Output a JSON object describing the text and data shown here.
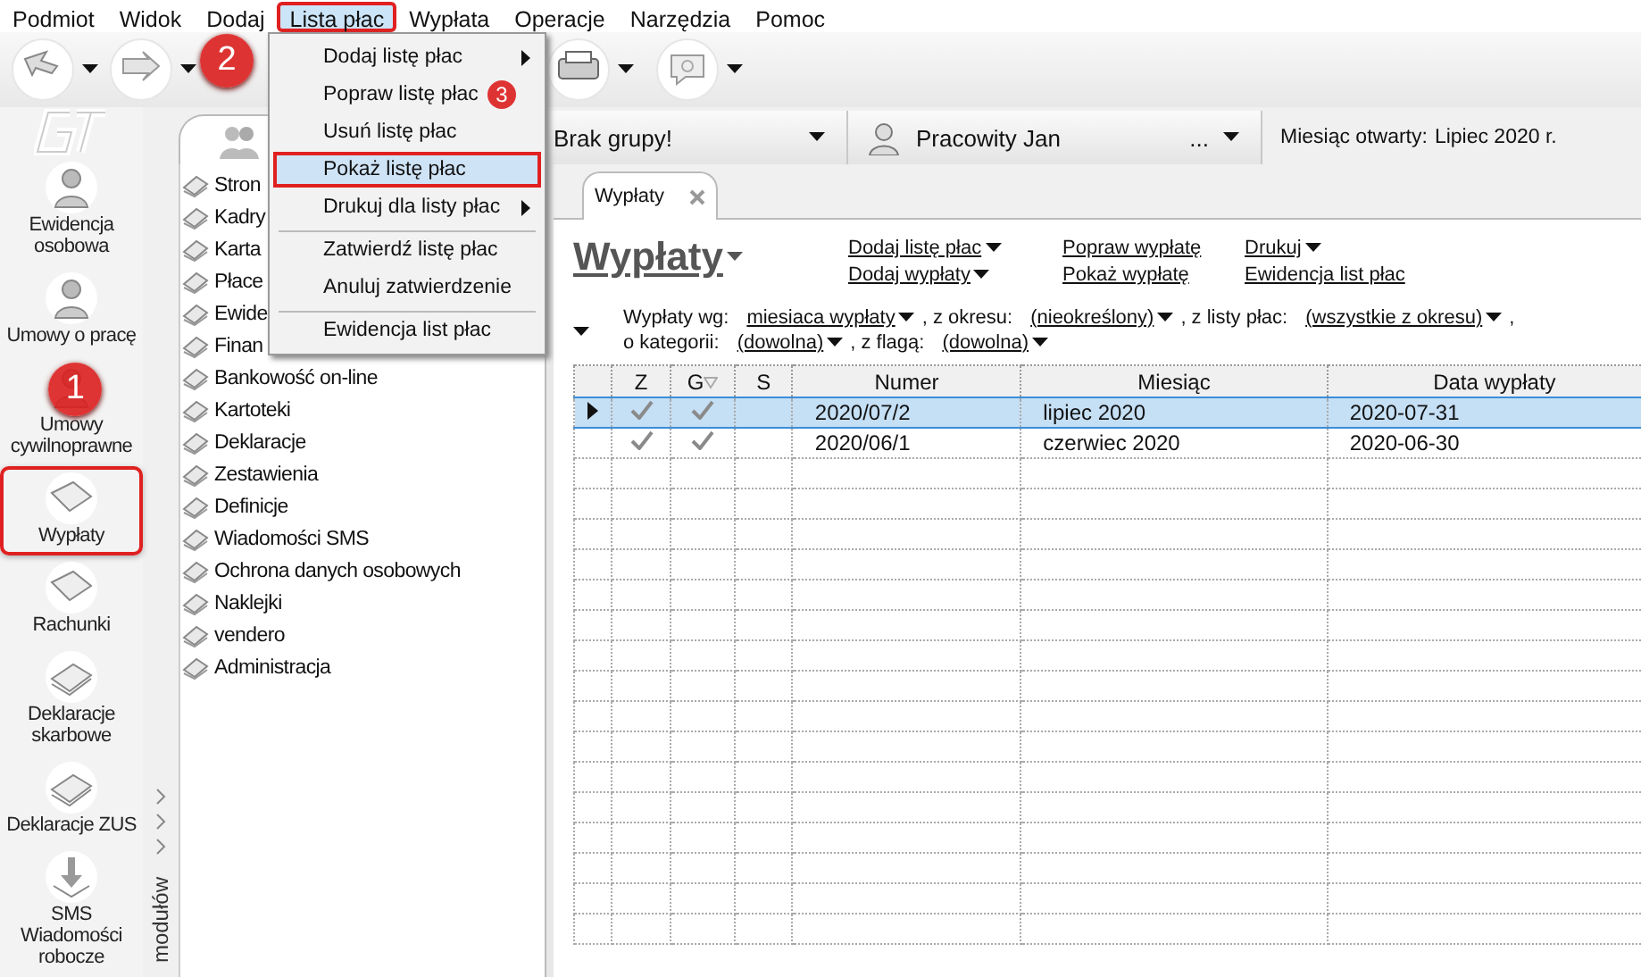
{
  "menu_bar": [
    {
      "label": "Podmiot",
      "highlighted": false
    },
    {
      "label": "Widok",
      "highlighted": false
    },
    {
      "label": "Dodaj",
      "highlighted": false
    },
    {
      "label": "Lista płac",
      "highlighted": true
    },
    {
      "label": "Wypłata",
      "highlighted": false
    },
    {
      "label": "Operacje",
      "highlighted": false
    },
    {
      "label": "Narzędzia",
      "highlighted": false
    },
    {
      "label": "Pomoc",
      "highlighted": false
    }
  ],
  "modules": [
    {
      "label": "Ewidencja osobowa",
      "highlighted": false
    },
    {
      "label": "Umowy o pracę",
      "highlighted": false
    },
    {
      "label": "Umowy cywilnoprawne",
      "highlighted": false
    },
    {
      "label": "Wypłaty",
      "highlighted": true
    },
    {
      "label": "Rachunki",
      "highlighted": false
    },
    {
      "label": "Deklaracje skarbowe",
      "highlighted": false
    },
    {
      "label": "Deklaracje ZUS",
      "highlighted": false
    },
    {
      "label": "SMS Wiadomości robocze",
      "highlighted": false
    }
  ],
  "modules_strip": {
    "label": "modułów"
  },
  "navigation": [
    {
      "label": "Stron"
    },
    {
      "label": "Kadry"
    },
    {
      "label": "Karta"
    },
    {
      "label": "Płace"
    },
    {
      "label": "Ewide"
    },
    {
      "label": "Finan"
    },
    {
      "label": "Bankowość on-line"
    },
    {
      "label": "Kartoteki"
    },
    {
      "label": "Deklaracje"
    },
    {
      "label": "Zestawienia"
    },
    {
      "label": "Definicje"
    },
    {
      "label": "Wiadomości SMS"
    },
    {
      "label": "Ochrona danych osobowych"
    },
    {
      "label": "Naklejki"
    },
    {
      "label": "vendero"
    },
    {
      "label": "Administracja"
    }
  ],
  "group_selector": {
    "value": "Brak grupy!"
  },
  "employee_selector": {
    "value": "Pracowity Jan",
    "more": "..."
  },
  "open_month": {
    "label": "Miesiąc otwarty:",
    "value": "Lipiec 2020 r."
  },
  "document_tabs": [
    {
      "label": "Wypłaty",
      "selected": true
    }
  ],
  "page_title": "Wypłaty",
  "actions": [
    {
      "label": "Dodaj listę płac",
      "dropdown": true
    },
    {
      "label": "Popraw wypłatę",
      "dropdown": false
    },
    {
      "label": "Drukuj",
      "dropdown": true
    },
    {
      "label": "Dodaj wypłaty",
      "dropdown": true
    },
    {
      "label": "Pokaż wypłatę",
      "dropdown": false
    },
    {
      "label": "Ewidencja list płac",
      "dropdown": false
    }
  ],
  "filter_lines": [
    {
      "items": [
        {
          "label": "Wypłaty wg:",
          "value": "miesiaca wypłaty"
        },
        {
          "label": ", z okresu:",
          "value": "(nieokreślony)"
        },
        {
          "label": ", z listy płac:",
          "value": "(wszystkie z okresu)"
        },
        {
          "label": ","
        }
      ]
    },
    {
      "items": [
        {
          "label": "o kategorii:",
          "value": "(dowolna)"
        },
        {
          "label": ", z flagą:",
          "value": "(dowolna)"
        }
      ]
    }
  ],
  "table": {
    "columns": [
      "Z",
      "G",
      "S",
      "Numer",
      "Miesiąc",
      "Data wypłaty"
    ],
    "rows": [
      {
        "selected": true,
        "z_checked": true,
        "g_checked": true,
        "number": "2020/07/2",
        "month": "lipiec 2020",
        "date": "2020-07-31"
      },
      {
        "selected": false,
        "z_checked": true,
        "g_checked": true,
        "number": "2020/06/1",
        "month": "czerwiec 2020",
        "date": "2020-06-30"
      }
    ]
  },
  "dropdown_menu": [
    {
      "label": "Dodaj listę płac",
      "submenu": true,
      "selected": false,
      "highlighted": false,
      "separator_before": false
    },
    {
      "label": "Popraw listę płac",
      "submenu": false,
      "selected": false,
      "highlighted": false,
      "separator_before": false
    },
    {
      "label": "Usuń listę płac",
      "submenu": false,
      "selected": false,
      "highlighted": false,
      "separator_before": false
    },
    {
      "label": "Pokaż listę płac",
      "submenu": false,
      "selected": true,
      "highlighted": true,
      "separator_before": false
    },
    {
      "label": "Drukuj dla listy płac",
      "submenu": true,
      "selected": false,
      "highlighted": false,
      "separator_before": false
    },
    {
      "label": "Zatwierdź listę płac",
      "submenu": false,
      "selected": false,
      "highlighted": false,
      "separator_before": true
    },
    {
      "label": "Anuluj zatwierdzenie",
      "submenu": false,
      "selected": false,
      "highlighted": false,
      "separator_before": false
    },
    {
      "label": "Ewidencja list płac",
      "submenu": false,
      "selected": false,
      "highlighted": false,
      "separator_before": true
    }
  ],
  "callouts": [
    {
      "label": "1"
    },
    {
      "label": "2"
    },
    {
      "label": "3"
    }
  ]
}
